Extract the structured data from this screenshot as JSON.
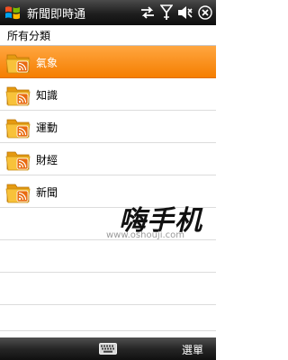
{
  "titlebar": {
    "app_title": "新聞即時通",
    "start_icon": "windows-start-icon",
    "status_icons": [
      "data-sync-icon",
      "signal-icon",
      "volume-muted-icon",
      "close-icon"
    ]
  },
  "section": {
    "label": "所有分類"
  },
  "categories": [
    {
      "label": "氣象",
      "icon": "rss-folder-icon",
      "selected": true
    },
    {
      "label": "知識",
      "icon": "rss-folder-icon",
      "selected": false
    },
    {
      "label": "運動",
      "icon": "rss-folder-icon",
      "selected": false
    },
    {
      "label": "財經",
      "icon": "rss-folder-icon",
      "selected": false
    },
    {
      "label": "新聞",
      "icon": "rss-folder-icon",
      "selected": false
    }
  ],
  "watermark": {
    "logo": "嗨手机",
    "url": "www.oshouji.com"
  },
  "menubar": {
    "keyboard_icon": "keyboard-icon",
    "right_softkey": "選單"
  },
  "colors": {
    "selection": "#f57e00",
    "folder": "#f5b21b",
    "rss_badge": "#e96b10"
  }
}
